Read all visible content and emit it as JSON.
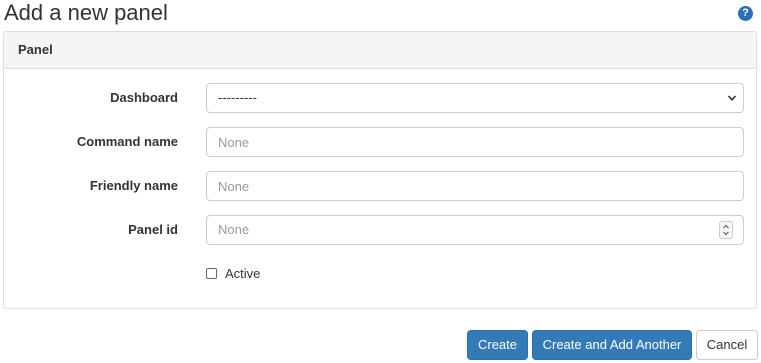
{
  "page": {
    "title": "Add a new panel"
  },
  "help": {
    "icon": "help-icon",
    "glyph": "?"
  },
  "panel": {
    "heading": "Panel"
  },
  "form": {
    "dashboard": {
      "label": "Dashboard",
      "value": "---------"
    },
    "command_name": {
      "label": "Command name",
      "placeholder": "None"
    },
    "friendly_name": {
      "label": "Friendly name",
      "placeholder": "None"
    },
    "panel_id": {
      "label": "Panel id",
      "placeholder": "None"
    },
    "active": {
      "label": "Active",
      "checked": false
    }
  },
  "actions": {
    "create": "Create",
    "create_add_another": "Create and Add Another",
    "cancel": "Cancel"
  },
  "colors": {
    "primary": "#337ab7",
    "help": "#2a70b8",
    "heading_bg": "#f5f5f5"
  }
}
